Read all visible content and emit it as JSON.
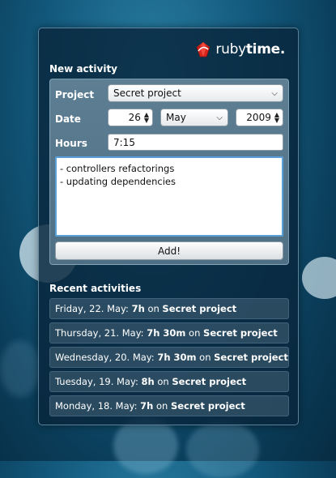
{
  "logo": {
    "text_light": "ruby",
    "text_bold": "time.",
    "icon": "ruby-gem-icon"
  },
  "new_activity": {
    "title": "New activity",
    "project_label": "Project",
    "project_value": "Secret project",
    "date_label": "Date",
    "date_day": "26",
    "date_month": "May",
    "date_year": "2009",
    "hours_label": "Hours",
    "hours_value": "7:15",
    "comments_value": "- controllers refactorings\n- updating dependencies",
    "add_button": "Add!"
  },
  "recent": {
    "title": "Recent activities",
    "items": [
      {
        "date": "Friday, 22. May:",
        "hours": "7h",
        "on": "on",
        "project": "Secret project"
      },
      {
        "date": "Thursday, 21. May:",
        "hours": "7h 30m",
        "on": "on",
        "project": "Secret project"
      },
      {
        "date": "Wednesday, 20. May:",
        "hours": "7h 30m",
        "on": "on",
        "project": "Secret project"
      },
      {
        "date": "Tuesday, 19. May:",
        "hours": "8h",
        "on": "on",
        "project": "Secret project"
      },
      {
        "date": "Monday, 18. May:",
        "hours": "7h",
        "on": "on",
        "project": "Secret project"
      }
    ]
  },
  "colors": {
    "background": "#135a7e",
    "panel": "#08263c",
    "textarea_border": "#5aa0d8"
  }
}
